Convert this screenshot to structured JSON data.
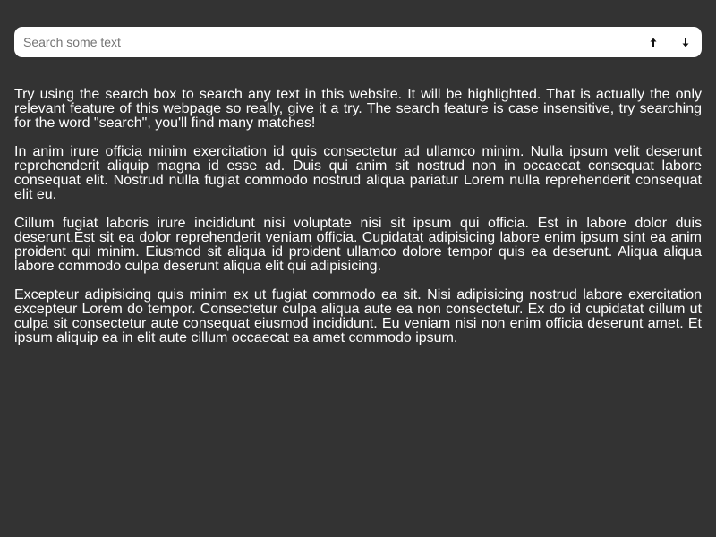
{
  "search": {
    "placeholder": "Search some text",
    "value": "",
    "prev_icon": "arrow-up-icon",
    "next_icon": "arrow-down-icon"
  },
  "content": {
    "paragraphs": [
      "Try using the search box to search any text in this website. It will be highlighted. That is actually the only relevant feature of this webpage so really, give it a try. The search feature is case insensitive, try searching for the word \"search\", you'll find many matches!",
      "In anim irure officia minim exercitation id quis consectetur ad ullamco minim. Nulla ipsum velit deserunt reprehenderit aliquip magna id esse ad. Duis qui anim sit nostrud non in occaecat consequat labore consequat elit. Nostrud nulla fugiat commodo nostrud aliqua pariatur Lorem nulla reprehenderit consequat elit eu.",
      "Cillum fugiat laboris irure incididunt nisi voluptate nisi sit ipsum qui officia. Est in labore dolor duis deserunt.Est sit ea dolor reprehenderit veniam officia. Cupidatat adipisicing labore enim ipsum sint ea anim proident qui minim. Eiusmod sit aliqua id proident ullamco dolore tempor quis ea deserunt. Aliqua aliqua labore commodo culpa deserunt aliqua elit qui adipisicing.",
      "Excepteur adipisicing quis minim ex ut fugiat commodo ea sit. Nisi adipisicing nostrud labore exercitation excepteur Lorem do tempor. Consectetur culpa aliqua aute ea non consectetur. Ex do id cupidatat cillum ut culpa sit consectetur aute consequat eiusmod incididunt. Eu veniam nisi non enim officia deserunt amet. Et ipsum aliquip ea in elit aute cillum occaecat ea amet commodo ipsum."
    ]
  },
  "colors": {
    "background": "#333333",
    "text": "#ffffff",
    "search_background": "#ffffff"
  }
}
